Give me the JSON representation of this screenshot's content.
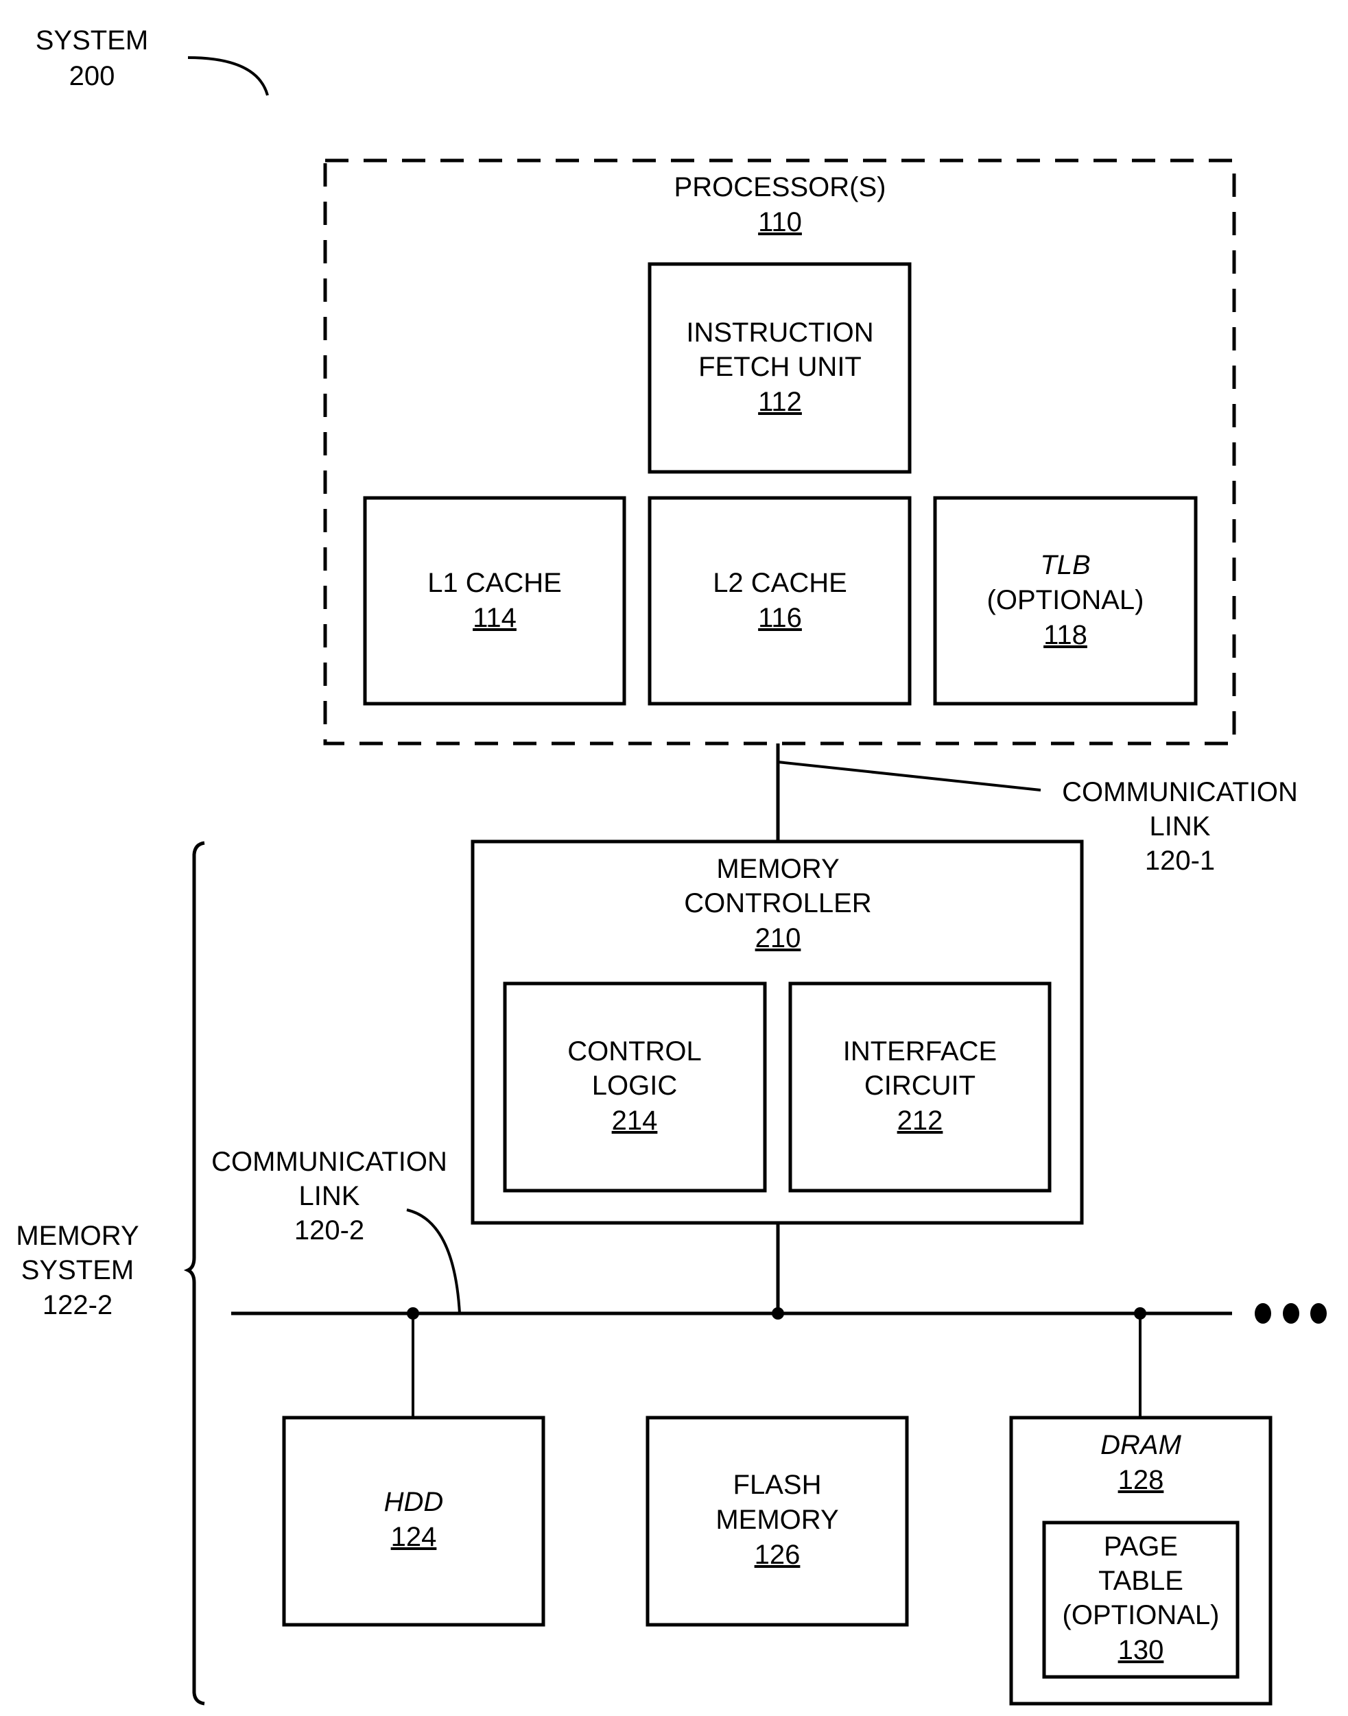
{
  "system_label": {
    "name": "SYSTEM",
    "ref": "200"
  },
  "processor": {
    "name": "PROCESSOR(S)",
    "ref": "110",
    "components": {
      "ifu": {
        "lines": [
          "INSTRUCTION",
          "FETCH UNIT"
        ],
        "ref": "112"
      },
      "l1": {
        "lines": [
          "L1 CACHE"
        ],
        "ref": "114"
      },
      "l2": {
        "lines": [
          "L2 CACHE"
        ],
        "ref": "116"
      },
      "tlb": {
        "lines": [
          "TLB",
          "(OPTIONAL)"
        ],
        "ref": "118"
      }
    }
  },
  "link_1": {
    "lines": [
      "COMMUNICATION",
      "LINK",
      "120-1"
    ]
  },
  "memory_controller": {
    "lines": [
      "MEMORY",
      "CONTROLLER"
    ],
    "ref": "210",
    "control_logic": {
      "lines": [
        "CONTROL",
        "LOGIC"
      ],
      "ref": "214"
    },
    "interface_circuit": {
      "lines": [
        "INTERFACE",
        "CIRCUIT"
      ],
      "ref": "212"
    }
  },
  "link_2": {
    "lines": [
      "COMMUNICATION",
      "LINK",
      "120-2"
    ]
  },
  "memory_system": {
    "lines": [
      "MEMORY",
      "SYSTEM",
      "122-2"
    ]
  },
  "devices": {
    "hdd": {
      "name": "HDD",
      "ref": "124"
    },
    "flash": {
      "lines": [
        "FLASH",
        "MEMORY"
      ],
      "ref": "126"
    },
    "dram": {
      "name": "DRAM",
      "ref": "128"
    },
    "page_table": {
      "lines": [
        "PAGE",
        "TABLE",
        "(OPTIONAL)"
      ],
      "ref": "130"
    }
  },
  "bus_continuation": "more devices"
}
